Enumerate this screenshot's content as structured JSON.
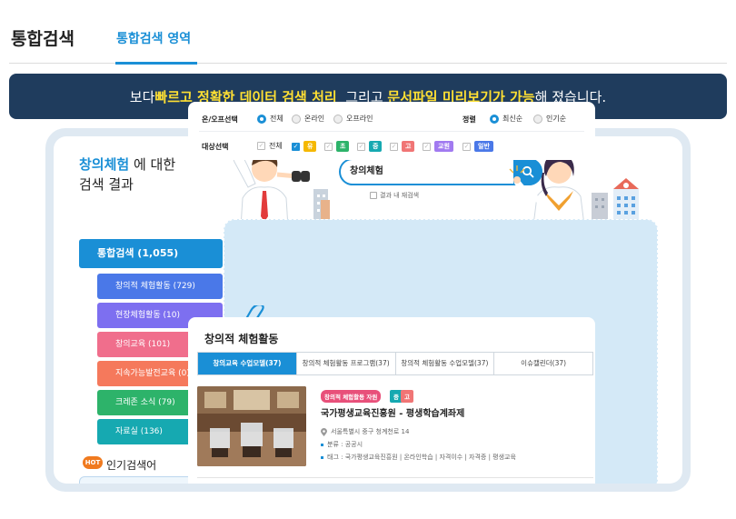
{
  "header": {
    "title": "통합검색",
    "tab_label": "통합검색 영역"
  },
  "banner": {
    "prefix": "보다 ",
    "highlight1": "빠르고 정확한 데이터 검색 처리",
    "middle": "  그리고 ",
    "highlight2": "문서파일 미리보기가 가능",
    "suffix": "해 졌습니다."
  },
  "result": {
    "keyword": "창의체험",
    "heading_suffix": " 에 대한",
    "heading_line2": "검색 결과"
  },
  "search": {
    "value": "창의체험",
    "in_result_label": "결과 내 재검색"
  },
  "sidebar": {
    "main_label": "통합검색 (1,055)",
    "items": [
      {
        "label": "창의적 체험활동 (729)",
        "color": "#4a78e8"
      },
      {
        "label": "현장체험활동 (10)",
        "color": "#7d6ff0"
      },
      {
        "label": "창의교육 (101)",
        "color": "#f06e8c"
      },
      {
        "label": "지속가능발전교육 (0)",
        "color": "#f5795c"
      },
      {
        "label": "크레존 소식 (79)",
        "color": "#2db36a"
      },
      {
        "label": "자료실 (136)",
        "color": "#16a9b1"
      }
    ],
    "hot_label": "HOT",
    "popular_label": "인기검색어"
  },
  "filters": {
    "online_label": "온/오프선택",
    "online_options": [
      "전체",
      "온라인",
      "오프라인"
    ],
    "sort_label": "정렬",
    "sort_options": [
      "최신순",
      "인기순"
    ],
    "target_label": "대상선택",
    "target_all": "전체",
    "target_tags": [
      {
        "label": "유",
        "color": "#f5b800"
      },
      {
        "label": "초",
        "color": "#2db36a"
      },
      {
        "label": "중",
        "color": "#16a9b1"
      },
      {
        "label": "고",
        "color": "#f07575"
      },
      {
        "label": "교원",
        "color": "#a17af0"
      },
      {
        "label": "일반",
        "color": "#4a78e8"
      }
    ]
  },
  "list": {
    "title": "창의적 체험활동",
    "tabs": [
      "창의교육 수업모델(37)",
      "창의적 체험활동 프로그램(37)",
      "창의적 체험활동 수업모델(37)",
      "이슈캘린더(37)"
    ],
    "item": {
      "category_badge": "창의적 체험활동 자원",
      "level_badges": [
        {
          "label": "중",
          "color": "#16a9b1"
        },
        {
          "label": "고",
          "color": "#f07575"
        }
      ],
      "title": "국가평생교육진흥원 - 평생학습계좌제",
      "address": "서울특별시 중구 청계천로 14",
      "category": "분류 : 공공시",
      "tags": "태그 : 국가평생교육진흥원 | 온라인학습 | 자격이수 | 자격증 | 평생교육"
    }
  },
  "colors": {
    "accent": "#1a8fd6",
    "banner_bg": "#1f3c5d",
    "banner_highlight": "#ffe033",
    "badge_pink": "#e8507a"
  }
}
